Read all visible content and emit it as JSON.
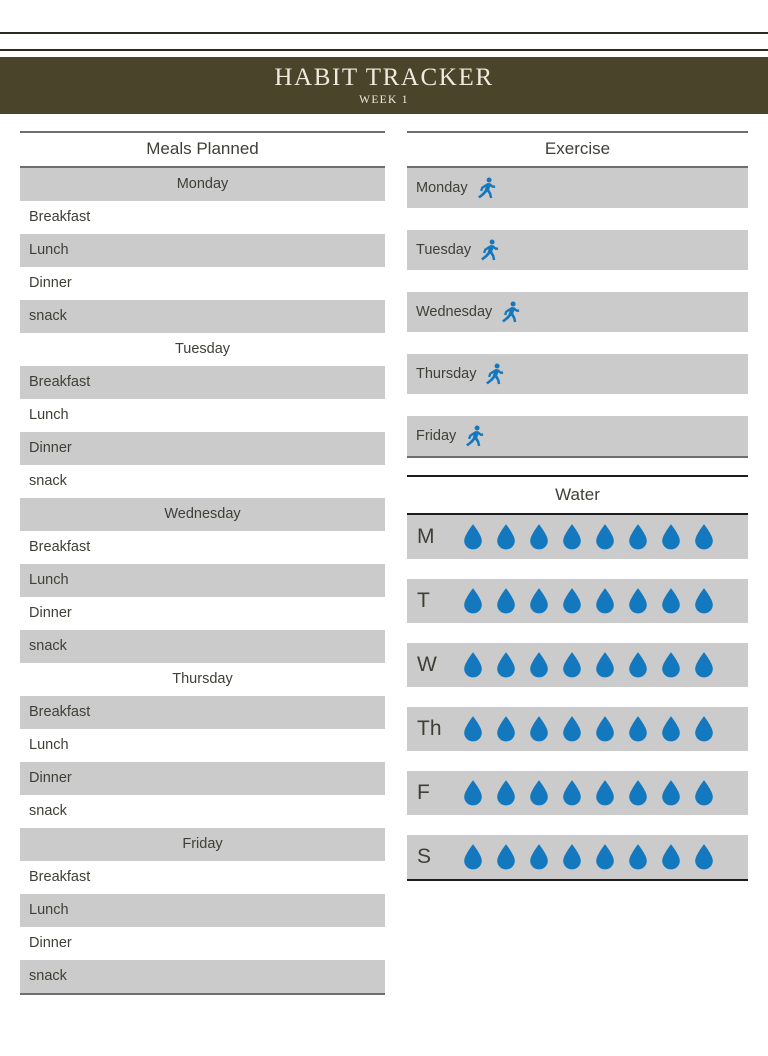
{
  "header": {
    "title": "HABIT TRACKER",
    "subtitle": "WEEK 1",
    "bg_color": "#4a442a",
    "text_color": "#efeade"
  },
  "colors": {
    "row_shade": "#cbcbcb",
    "rule": "#6e6e6e",
    "accent_blue": "#1478be",
    "text": "#3f3f38"
  },
  "meals": {
    "section_title": "Meals Planned",
    "rows": [
      {
        "label": "Monday",
        "type": "day",
        "shaded": true
      },
      {
        "label": "Breakfast",
        "type": "meal",
        "shaded": false
      },
      {
        "label": "Lunch",
        "type": "meal",
        "shaded": true
      },
      {
        "label": "Dinner",
        "type": "meal",
        "shaded": false
      },
      {
        "label": "snack",
        "type": "meal",
        "shaded": true
      },
      {
        "label": "Tuesday",
        "type": "day",
        "shaded": false
      },
      {
        "label": "Breakfast",
        "type": "meal",
        "shaded": true
      },
      {
        "label": "Lunch",
        "type": "meal",
        "shaded": false
      },
      {
        "label": "Dinner",
        "type": "meal",
        "shaded": true
      },
      {
        "label": "snack",
        "type": "meal",
        "shaded": false
      },
      {
        "label": "Wednesday",
        "type": "day",
        "shaded": true
      },
      {
        "label": "Breakfast",
        "type": "meal",
        "shaded": false
      },
      {
        "label": "Lunch",
        "type": "meal",
        "shaded": true
      },
      {
        "label": "Dinner",
        "type": "meal",
        "shaded": false
      },
      {
        "label": "snack",
        "type": "meal",
        "shaded": true
      },
      {
        "label": "Thursday",
        "type": "day",
        "shaded": false
      },
      {
        "label": "Breakfast",
        "type": "meal",
        "shaded": true
      },
      {
        "label": "Lunch",
        "type": "meal",
        "shaded": false
      },
      {
        "label": "Dinner",
        "type": "meal",
        "shaded": true
      },
      {
        "label": "snack",
        "type": "meal",
        "shaded": false
      },
      {
        "label": "Friday",
        "type": "day",
        "shaded": true
      },
      {
        "label": "Breakfast",
        "type": "meal",
        "shaded": false
      },
      {
        "label": "Lunch",
        "type": "meal",
        "shaded": true
      },
      {
        "label": "Dinner",
        "type": "meal",
        "shaded": false
      },
      {
        "label": "snack",
        "type": "meal",
        "shaded": true
      }
    ]
  },
  "exercise": {
    "section_title": "Exercise",
    "icon": "running-person-icon",
    "rows": [
      {
        "label": "Monday"
      },
      {
        "label": "Tuesday"
      },
      {
        "label": "Wednesday"
      },
      {
        "label": "Thursday"
      },
      {
        "label": "Friday"
      }
    ]
  },
  "water": {
    "section_title": "Water",
    "icon": "water-drop-icon",
    "drops_per_row": 8,
    "rows": [
      {
        "label": "M",
        "drops": 8
      },
      {
        "label": "T",
        "drops": 8
      },
      {
        "label": "W",
        "drops": 8
      },
      {
        "label": "Th",
        "drops": 8
      },
      {
        "label": "F",
        "drops": 8
      },
      {
        "label": "S",
        "drops": 8
      }
    ]
  }
}
